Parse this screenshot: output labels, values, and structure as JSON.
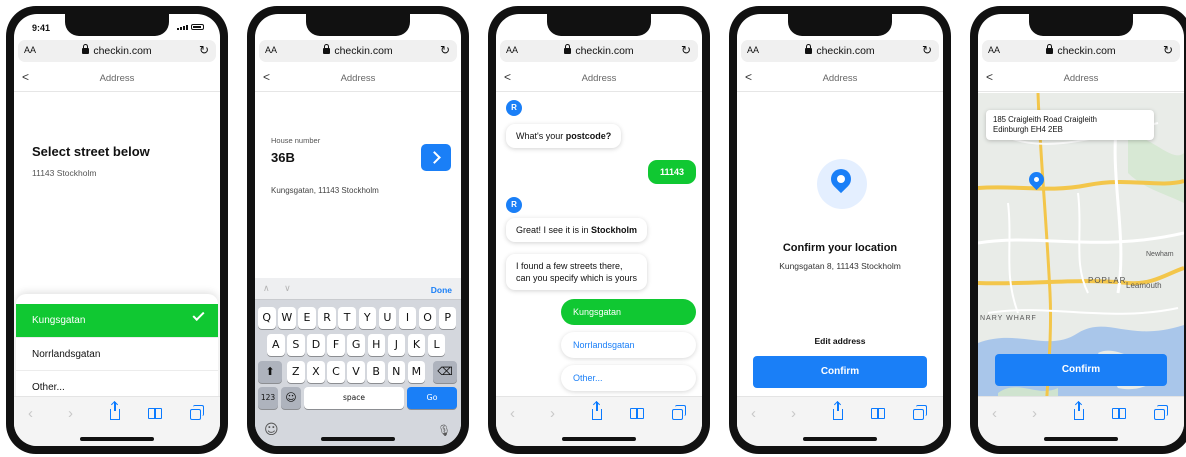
{
  "status": {
    "time": "9:41"
  },
  "browser": {
    "aa": "AA",
    "host": "checkin.com",
    "reload": "↻"
  },
  "nav": {
    "title": "Address",
    "back": "<"
  },
  "toolbar": {
    "back": "‹",
    "forward": "›"
  },
  "screen1": {
    "title": "Select street below",
    "subtitle": "11143 Stockholm",
    "options": [
      {
        "label": "Kungsgatan",
        "selected": true
      },
      {
        "label": "Norrlandsgatan",
        "selected": false
      },
      {
        "label": "Other...",
        "selected": false
      }
    ]
  },
  "screen2": {
    "field_label": "House number",
    "field_value": "36B",
    "address": "Kungsgatan, 11143 Stockholm",
    "keyboard": {
      "done": "Done",
      "arrows": "∧ ∨",
      "row1": [
        "Q",
        "W",
        "E",
        "R",
        "T",
        "Y",
        "U",
        "I",
        "O",
        "P"
      ],
      "row2": [
        "A",
        "S",
        "D",
        "F",
        "G",
        "H",
        "J",
        "K",
        "L"
      ],
      "row3": [
        "Z",
        "X",
        "C",
        "V",
        "B",
        "N",
        "M"
      ],
      "shift": "⬆",
      "backspace": "⌫",
      "numbers": "123",
      "emoji": "☺",
      "space": "space",
      "go": "Go",
      "emoji_bottom": "☺",
      "mic": "🎙"
    }
  },
  "screen3": {
    "avatar": "R",
    "q1_prefix": "What's your ",
    "q1_bold": "postcode?",
    "answer1": "11143",
    "msg2_prefix": "Great! I see it is in ",
    "msg2_bold": "Stockholm",
    "msg3_line1": "I found a few streets there,",
    "msg3_line2": "can you specify which is yours",
    "choices": [
      "Kungsgatan",
      "Norrlandsgatan",
      "Other..."
    ]
  },
  "screen4": {
    "title": "Confirm your location",
    "address": "Kungsgatan 8, 11143 Stockholm",
    "edit": "Edit address",
    "confirm": "Confirm"
  },
  "screen5": {
    "card_line1": "185 Craigleith Road Craigleith",
    "card_line2": "Edinburgh EH4 2EB",
    "labels": {
      "poplar": "POPLAR",
      "leamouth": "Leamouth",
      "wharf": "NARY WHARF",
      "newham": "Newham"
    },
    "confirm": "Confirm"
  },
  "colors": {
    "accent": "#1a7ff7",
    "green": "#10c832"
  }
}
